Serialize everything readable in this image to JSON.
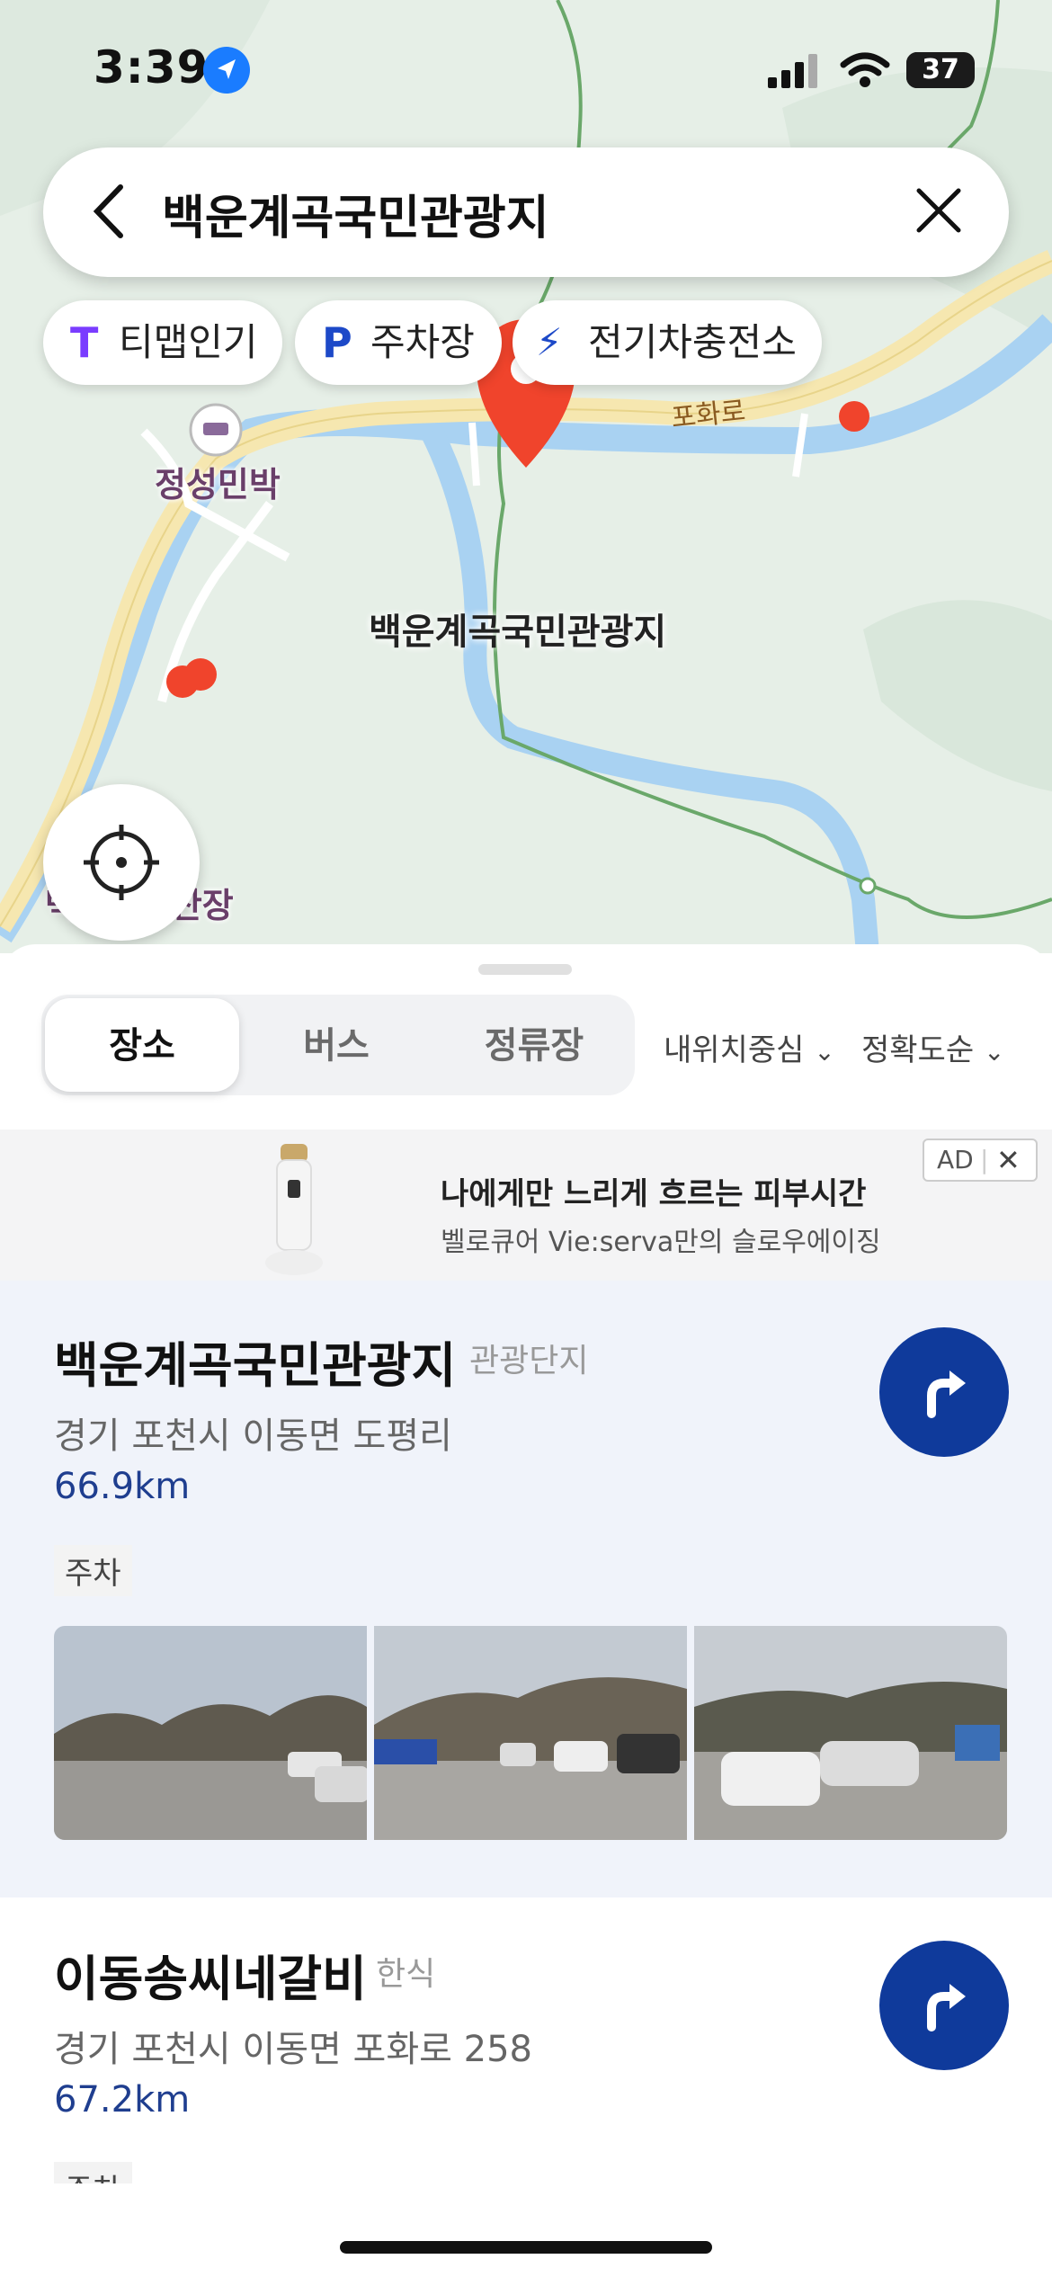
{
  "status_bar": {
    "time": "3:39",
    "battery": "37",
    "battery_level": 0.37
  },
  "search": {
    "query": "백운계곡국민관광지"
  },
  "chips": [
    {
      "icon": "T",
      "label": "티맵인기"
    },
    {
      "icon": "P",
      "label": "주차장"
    },
    {
      "icon": "⚡",
      "label": "전기차충전소"
    }
  ],
  "map": {
    "road_label": "포화로",
    "poi_top": "정성민박",
    "poi_bottom": "백운계곡산장",
    "selected_poi": "백운계곡국민관광지"
  },
  "tabs": [
    {
      "label": "장소",
      "active": true
    },
    {
      "label": "버스",
      "active": false
    },
    {
      "label": "정류장",
      "active": false
    }
  ],
  "sort": {
    "center": "내위치중심",
    "order": "정확도순"
  },
  "ad": {
    "title": "나에게만 느리게 흐르는 피부시간",
    "subtitle": "벨로큐어 Vie:serva만의 슬로우에이징",
    "badge": "AD"
  },
  "results": [
    {
      "name": "백운계곡국민관광지",
      "category": "관광단지",
      "address": "경기 포천시 이동면 도평리",
      "distance": "66.9km",
      "tag": "주차"
    },
    {
      "name": "이동송씨네갈비",
      "category": "한식",
      "address": "경기 포천시 이동면 포화로 258",
      "distance": "67.2km",
      "tag": "주차"
    }
  ],
  "colors": {
    "accent": "#0f3a9b",
    "pin": "#f0442c",
    "distance": "#1f3e8f"
  }
}
